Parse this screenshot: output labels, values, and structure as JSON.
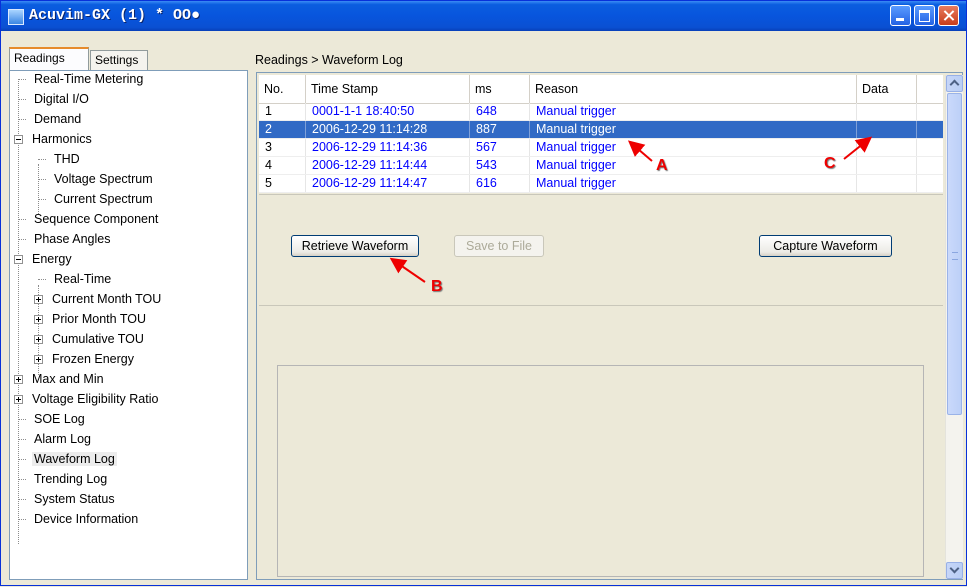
{
  "window": {
    "title": "Acuvim-GX (1) * OO●"
  },
  "tabs": {
    "readings": "Readings",
    "settings": "Settings"
  },
  "tree": {
    "real_time_metering": "Real-Time Metering",
    "digital_io": "Digital I/O",
    "demand": "Demand",
    "harmonics": "Harmonics",
    "thd": "THD",
    "voltage_spectrum": "Voltage Spectrum",
    "current_spectrum": "Current Spectrum",
    "sequence_component": "Sequence Component",
    "phase_angles": "Phase Angles",
    "energy": "Energy",
    "real_time": "Real-Time",
    "current_month_tou": "Current Month TOU",
    "prior_month_tou": "Prior Month TOU",
    "cumulative_tou": "Cumulative TOU",
    "frozen_energy": "Frozen Energy",
    "max_and_min": "Max and Min",
    "voltage_eligibility_ratio": "Voltage Eligibility Ratio",
    "soe_log": "SOE Log",
    "alarm_log": "Alarm Log",
    "waveform_log": "Waveform Log",
    "trending_log": "Trending Log",
    "system_status": "System Status",
    "device_information": "Device Information"
  },
  "breadcrumb": "Readings > Waveform Log",
  "table": {
    "headers": {
      "no": "No.",
      "timestamp": "Time Stamp",
      "ms": "ms",
      "reason": "Reason",
      "data": "Data"
    },
    "rows": [
      {
        "no": "1",
        "timestamp": "0001-1-1 18:40:50",
        "ms": "648",
        "reason": "Manual trigger"
      },
      {
        "no": "2",
        "timestamp": "2006-12-29 11:14:28",
        "ms": "887",
        "reason": "Manual trigger"
      },
      {
        "no": "3",
        "timestamp": "2006-12-29 11:14:36",
        "ms": "567",
        "reason": "Manual trigger"
      },
      {
        "no": "4",
        "timestamp": "2006-12-29 11:14:44",
        "ms": "543",
        "reason": "Manual trigger"
      },
      {
        "no": "5",
        "timestamp": "2006-12-29 11:14:47",
        "ms": "616",
        "reason": "Manual trigger"
      }
    ],
    "selected_row": 2
  },
  "buttons": {
    "retrieve_waveform": "Retrieve Waveform",
    "save_to_file": "Save to File",
    "capture_waveform": "Capture Waveform"
  },
  "annotations": {
    "a": "A",
    "b": "B",
    "c": "C",
    "color": "#ee0000"
  }
}
